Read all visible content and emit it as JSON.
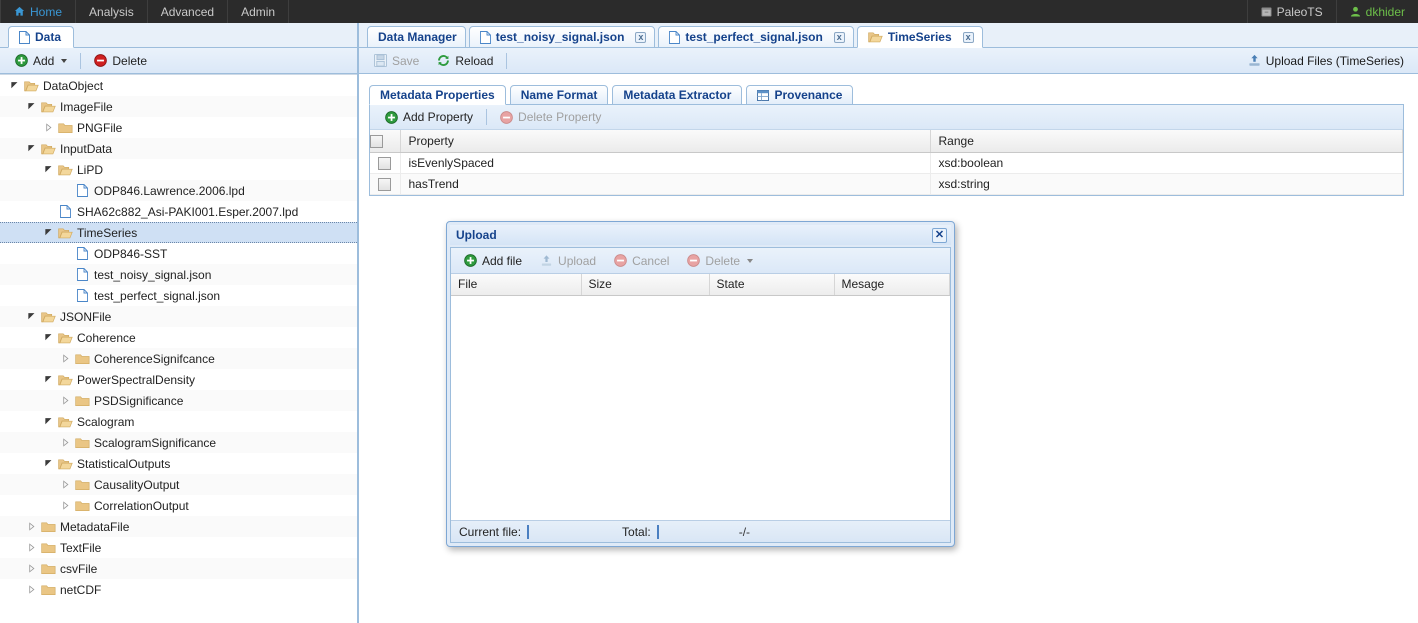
{
  "navbar": {
    "items": [
      {
        "label": "Home",
        "icon": "home-icon",
        "active": true
      },
      {
        "label": "Analysis",
        "icon": "",
        "active": false
      },
      {
        "label": "Advanced",
        "icon": "",
        "active": false
      },
      {
        "label": "Admin",
        "icon": "",
        "active": false
      }
    ],
    "right": [
      {
        "label": "PaleoTS",
        "icon": "archive-icon"
      },
      {
        "label": "dkhider",
        "icon": "user-icon"
      }
    ],
    "background": "#2b2b2b",
    "home_color": "#3a97d4",
    "user_color": "#6dbf4a"
  },
  "left_panel": {
    "tab": {
      "label": "Data",
      "icon": "file-icon"
    },
    "toolbar": {
      "add_label": "Add",
      "add_icon": "plus-circle-icon",
      "delete_label": "Delete",
      "delete_icon": "minus-circle-icon"
    },
    "tree": [
      {
        "label": "DataObject",
        "depth": 0,
        "state": "expanded",
        "type": "folder"
      },
      {
        "label": "ImageFile",
        "depth": 1,
        "state": "expanded",
        "type": "folder"
      },
      {
        "label": "PNGFile",
        "depth": 2,
        "state": "collapsed",
        "type": "folder"
      },
      {
        "label": "InputData",
        "depth": 1,
        "state": "expanded",
        "type": "folder"
      },
      {
        "label": "LiPD",
        "depth": 2,
        "state": "expanded",
        "type": "folder"
      },
      {
        "label": "ODP846.Lawrence.2006.lpd",
        "depth": 3,
        "state": "leaf",
        "type": "file"
      },
      {
        "label": "SHA62c882_Asi-PAKI001.Esper.2007.lpd",
        "depth": 2,
        "state": "leaf",
        "type": "file"
      },
      {
        "label": "TimeSeries",
        "depth": 2,
        "state": "expanded",
        "type": "folder",
        "selected": true
      },
      {
        "label": "ODP846-SST",
        "depth": 3,
        "state": "leaf",
        "type": "file"
      },
      {
        "label": "test_noisy_signal.json",
        "depth": 3,
        "state": "leaf",
        "type": "file"
      },
      {
        "label": "test_perfect_signal.json",
        "depth": 3,
        "state": "leaf",
        "type": "file"
      },
      {
        "label": "JSONFile",
        "depth": 1,
        "state": "expanded",
        "type": "folder"
      },
      {
        "label": "Coherence",
        "depth": 2,
        "state": "expanded",
        "type": "folder"
      },
      {
        "label": "CoherenceSignifcance",
        "depth": 3,
        "state": "collapsed",
        "type": "folder"
      },
      {
        "label": "PowerSpectralDensity",
        "depth": 2,
        "state": "expanded",
        "type": "folder"
      },
      {
        "label": "PSDSignificance",
        "depth": 3,
        "state": "collapsed",
        "type": "folder"
      },
      {
        "label": "Scalogram",
        "depth": 2,
        "state": "expanded",
        "type": "folder"
      },
      {
        "label": "ScalogramSignificance",
        "depth": 3,
        "state": "collapsed",
        "type": "folder"
      },
      {
        "label": "StatisticalOutputs",
        "depth": 2,
        "state": "expanded",
        "type": "folder"
      },
      {
        "label": "CausalityOutput",
        "depth": 3,
        "state": "collapsed",
        "type": "folder"
      },
      {
        "label": "CorrelationOutput",
        "depth": 3,
        "state": "collapsed",
        "type": "folder"
      },
      {
        "label": "MetadataFile",
        "depth": 1,
        "state": "collapsed",
        "type": "folder"
      },
      {
        "label": "TextFile",
        "depth": 1,
        "state": "collapsed",
        "type": "folder"
      },
      {
        "label": "csvFile",
        "depth": 1,
        "state": "collapsed",
        "type": "folder"
      },
      {
        "label": "netCDF",
        "depth": 1,
        "state": "collapsed",
        "type": "folder"
      }
    ]
  },
  "main_panel": {
    "tabs": [
      {
        "label": "Data Manager",
        "icon": "",
        "closable": false,
        "active": false
      },
      {
        "label": "test_noisy_signal.json",
        "icon": "file-icon",
        "closable": true,
        "active": false
      },
      {
        "label": "test_perfect_signal.json",
        "icon": "file-icon",
        "closable": true,
        "active": false
      },
      {
        "label": "TimeSeries",
        "icon": "folder-icon",
        "closable": true,
        "active": true
      }
    ],
    "tab_close_label": "x",
    "toolbar": {
      "save_label": "Save",
      "save_icon": "save-icon",
      "save_disabled": true,
      "reload_label": "Reload",
      "reload_icon": "refresh-icon",
      "upload_files_label": "Upload Files (TimeSeries)",
      "upload_files_icon": "upload-icon"
    },
    "subtabs": [
      {
        "label": "Metadata Properties",
        "icon": "",
        "active": true
      },
      {
        "label": "Name Format",
        "icon": "",
        "active": false
      },
      {
        "label": "Metadata Extractor",
        "icon": "",
        "active": false
      },
      {
        "label": "Provenance",
        "icon": "table-icon",
        "active": false
      }
    ],
    "grid_toolbar": {
      "add_property_label": "Add Property",
      "add_property_icon": "plus-circle-icon",
      "delete_property_label": "Delete Property",
      "delete_property_icon": "minus-circle-icon",
      "delete_property_disabled": true
    },
    "grid": {
      "columns": [
        "Property",
        "Range"
      ],
      "rows": [
        {
          "property": "isEvenlySpaced",
          "range": "xsd:boolean",
          "checked": false
        },
        {
          "property": "hasTrend",
          "range": "xsd:string",
          "checked": false
        }
      ]
    }
  },
  "dialog": {
    "title": "Upload",
    "close_label": "✕",
    "toolbar": [
      {
        "label": "Add file",
        "icon": "plus-circle-icon",
        "disabled": false,
        "caret": false
      },
      {
        "label": "Upload",
        "icon": "upload-icon",
        "disabled": true,
        "caret": false
      },
      {
        "label": "Cancel",
        "icon": "minus-circle-icon",
        "disabled": true,
        "caret": false
      },
      {
        "label": "Delete",
        "icon": "minus-circle-icon",
        "disabled": true,
        "caret": true
      }
    ],
    "columns": [
      "File",
      "Size",
      "State",
      "Mesage"
    ],
    "rows": [],
    "status": {
      "current_file_label": "Current file:",
      "total_label": "Total:",
      "ratio": "-/-"
    }
  }
}
